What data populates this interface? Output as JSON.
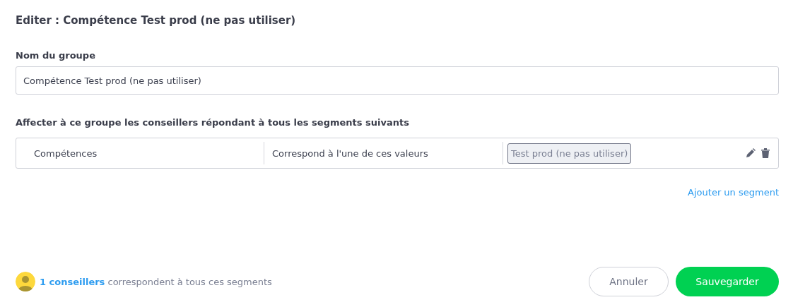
{
  "title": "Editer : Compétence Test prod (ne pas utiliser)",
  "group_name": {
    "label": "Nom du groupe",
    "value": "Compétence Test prod (ne pas utiliser)"
  },
  "segments_label": "Affecter à ce groupe les conseillers répondant à tous les segments suivants",
  "segments": [
    {
      "field": "Compétences",
      "operator": "Correspond à l'une de ces valeurs",
      "values": [
        "Test prod (ne pas utiliser)"
      ]
    }
  ],
  "add_segment": "Ajouter un segment",
  "summary": {
    "link": "1 conseillers",
    "text": "correspondent à tous ces segments"
  },
  "buttons": [
    {
      "label": "Annuler",
      "kind": "secondary"
    },
    {
      "label": "Sauvegarder",
      "kind": "primary"
    }
  ]
}
